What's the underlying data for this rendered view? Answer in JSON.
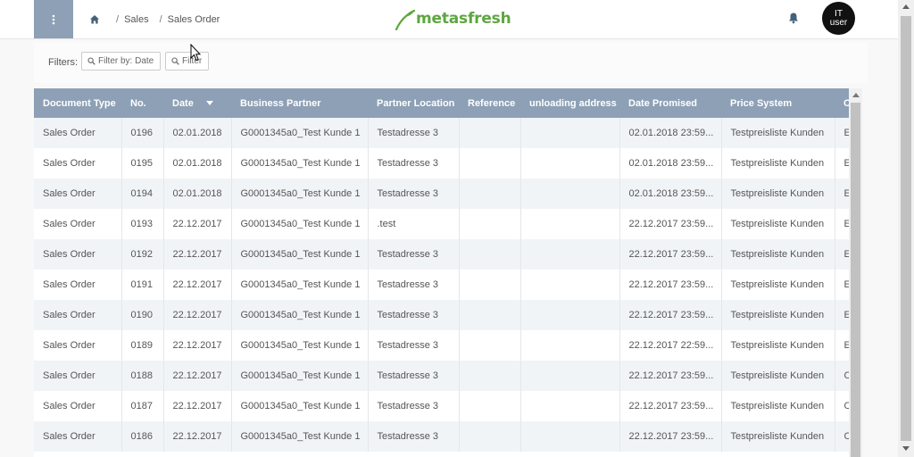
{
  "header": {
    "breadcrumbs": [
      "Sales",
      "Sales Order"
    ],
    "logo_text": "metasfresh",
    "user_line1": "IT",
    "user_line2": "user",
    "icons": {
      "menu": "menu-dots-icon",
      "home": "home-icon",
      "notifications": "bell-icon",
      "logo": "leaf-logo-icon"
    }
  },
  "filters": {
    "label": "Filters:",
    "date_filter": "Filter by: Date",
    "filter": "Filter"
  },
  "table": {
    "columns": [
      "Document Type",
      "No.",
      "Date",
      "Business Partner",
      "Partner Location",
      "Reference",
      "unloading address",
      "Date Promised",
      "Price System",
      "C"
    ],
    "sorted_column": "Date",
    "rows": [
      [
        "Sales Order",
        "0196",
        "02.01.2018",
        "G0001345a0_Test Kunde 1",
        "Testadresse 3",
        "",
        "",
        "02.01.2018 23:59...",
        "Testpreisliste Kunden",
        "E"
      ],
      [
        "Sales Order",
        "0195",
        "02.01.2018",
        "G0001345a0_Test Kunde 1",
        "Testadresse 3",
        "",
        "",
        "02.01.2018 23:59...",
        "Testpreisliste Kunden",
        "E"
      ],
      [
        "Sales Order",
        "0194",
        "02.01.2018",
        "G0001345a0_Test Kunde 1",
        "Testadresse 3",
        "",
        "",
        "02.01.2018 23:59...",
        "Testpreisliste Kunden",
        "E"
      ],
      [
        "Sales Order",
        "0193",
        "22.12.2017",
        "G0001345a0_Test Kunde 1",
        ".test",
        "",
        "",
        "22.12.2017 23:59...",
        "Testpreisliste Kunden",
        "E"
      ],
      [
        "Sales Order",
        "0192",
        "22.12.2017",
        "G0001345a0_Test Kunde 1",
        "Testadresse 3",
        "",
        "",
        "22.12.2017 23:59...",
        "Testpreisliste Kunden",
        "E"
      ],
      [
        "Sales Order",
        "0191",
        "22.12.2017",
        "G0001345a0_Test Kunde 1",
        "Testadresse 3",
        "",
        "",
        "22.12.2017 23:59...",
        "Testpreisliste Kunden",
        "E"
      ],
      [
        "Sales Order",
        "0190",
        "22.12.2017",
        "G0001345a0_Test Kunde 1",
        "Testadresse 3",
        "",
        "",
        "22.12.2017 23:59...",
        "Testpreisliste Kunden",
        "E"
      ],
      [
        "Sales Order",
        "0189",
        "22.12.2017",
        "G0001345a0_Test Kunde 1",
        "Testadresse 3",
        "",
        "",
        "22.12.2017 22:59...",
        "Testpreisliste Kunden",
        "E"
      ],
      [
        "Sales Order",
        "0188",
        "22.12.2017",
        "G0001345a0_Test Kunde 1",
        "Testadresse 3",
        "",
        "",
        "22.12.2017 23:59...",
        "Testpreisliste Kunden",
        "C"
      ],
      [
        "Sales Order",
        "0187",
        "22.12.2017",
        "G0001345a0_Test Kunde 1",
        "Testadresse 3",
        "",
        "",
        "22.12.2017 23:59...",
        "Testpreisliste Kunden",
        "C"
      ],
      [
        "Sales Order",
        "0186",
        "22.12.2017",
        "G0001345a0_Test Kunde 1",
        "Testadresse 3",
        "",
        "",
        "22.12.2017 23:59...",
        "Testpreisliste Kunden",
        "C"
      ]
    ]
  },
  "colors": {
    "header_bar": "#8da0b5",
    "logo_green": "#5ea640",
    "row_alt": "#f1f4f7"
  }
}
